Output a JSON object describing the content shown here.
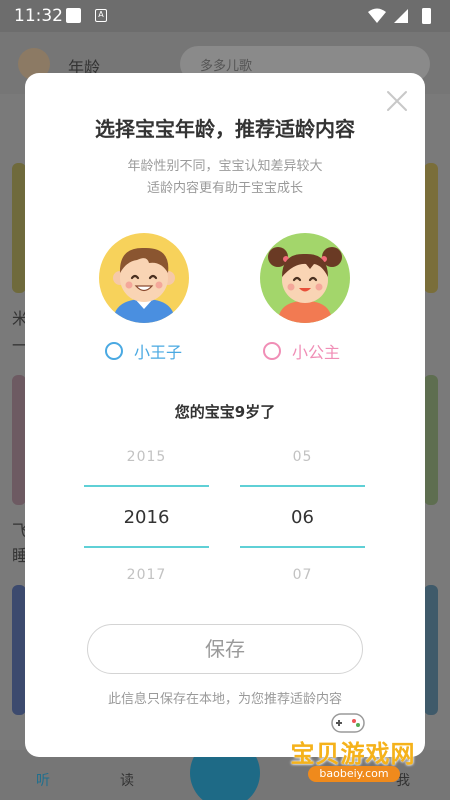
{
  "statusbar": {
    "time": "11:32",
    "notif_icon": "a-letter-icon"
  },
  "background": {
    "age_label": "年龄",
    "search_placeholder": "多多儿歌",
    "text_1": "米",
    "text_2": "一",
    "text_3": "飞",
    "text_4": "睡",
    "nav": {
      "listen": "听",
      "read": "读",
      "me": "我"
    }
  },
  "dialog": {
    "title": "选择宝宝年龄，推荐适龄内容",
    "subtitle_1": "年龄性别不同，宝宝认知差异较大",
    "subtitle_2": "适龄内容更有助于宝宝成长",
    "boy_label": "小王子",
    "girl_label": "小公主",
    "age_summary": "您的宝宝9岁了",
    "year_picker": {
      "prev": "2015",
      "selected": "2016",
      "next": "2017"
    },
    "month_picker": {
      "prev": "05",
      "selected": "06",
      "next": "07"
    },
    "save_label": "保存",
    "footer_note": "此信息只保存在本地，为您推荐适龄内容"
  },
  "watermark": {
    "text": "宝贝游戏网",
    "url": "baobeiy.com"
  },
  "colors": {
    "boy_accent": "#4aa9e2",
    "girl_accent": "#f08eb6",
    "picker_line": "#5fd0d6",
    "boy_avatar_bg": "#f7d25b",
    "girl_avatar_bg": "#a3d66b"
  }
}
